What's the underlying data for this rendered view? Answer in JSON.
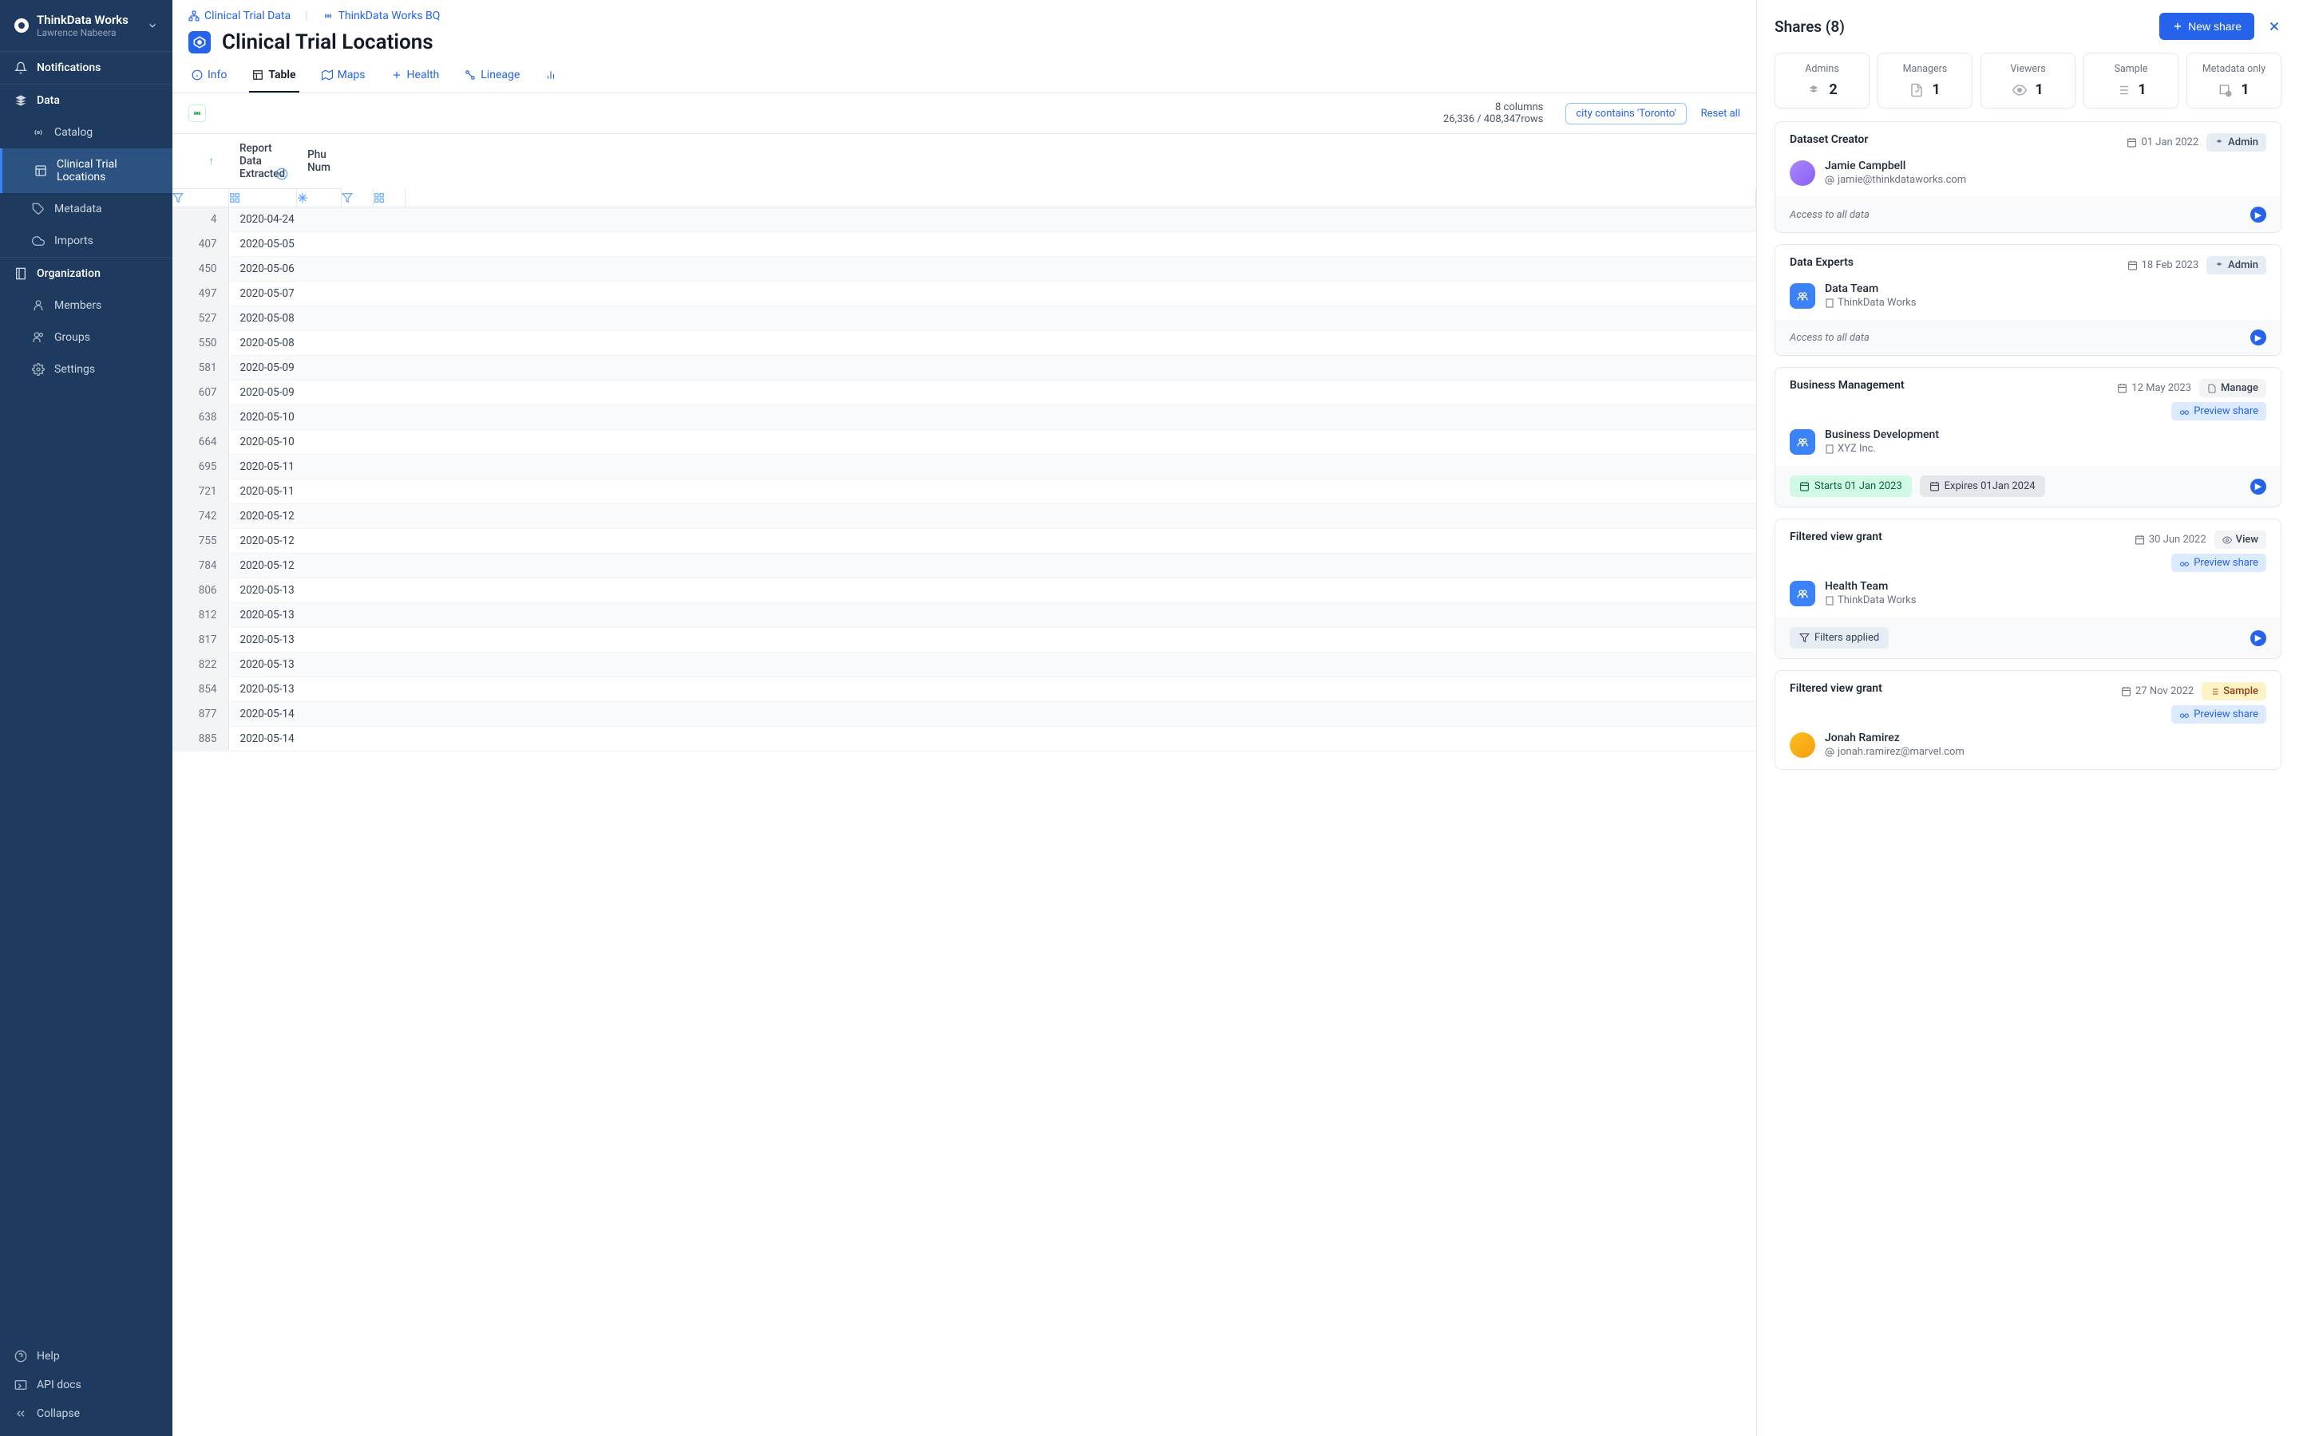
{
  "brand": {
    "name": "ThinkData Works",
    "user": "Lawrence Nabeera"
  },
  "sidebar": {
    "notifications": "Notifications",
    "data": "Data",
    "data_items": [
      "Catalog",
      "Clinical Trial Locations",
      "Metadata",
      "Imports"
    ],
    "organization": "Organization",
    "org_items": [
      "Members",
      "Groups",
      "Settings"
    ],
    "footer": [
      "Help",
      "API docs",
      "Collapse"
    ]
  },
  "breadcrumb": {
    "a": "Clinical Trial Data",
    "b": "ThinkData Works BQ"
  },
  "header": {
    "title": "Clinical Trial Locations"
  },
  "tabs": [
    "Info",
    "Table",
    "Maps",
    "Health",
    "Lineage"
  ],
  "filter": {
    "columns": "8 columns",
    "rows": "26,336 / 408,347rows",
    "chip": "city contains 'Toronto'",
    "reset": "Reset all"
  },
  "table": {
    "headers": [
      "Report Data Extracted",
      "Phu Num"
    ],
    "rows": [
      {
        "n": 4,
        "d": "2020-04-24"
      },
      {
        "n": 407,
        "d": "2020-05-05"
      },
      {
        "n": 450,
        "d": "2020-05-06"
      },
      {
        "n": 497,
        "d": "2020-05-07"
      },
      {
        "n": 527,
        "d": "2020-05-08"
      },
      {
        "n": 550,
        "d": "2020-05-08"
      },
      {
        "n": 581,
        "d": "2020-05-09"
      },
      {
        "n": 607,
        "d": "2020-05-09"
      },
      {
        "n": 638,
        "d": "2020-05-10"
      },
      {
        "n": 664,
        "d": "2020-05-10"
      },
      {
        "n": 695,
        "d": "2020-05-11"
      },
      {
        "n": 721,
        "d": "2020-05-11"
      },
      {
        "n": 742,
        "d": "2020-05-12"
      },
      {
        "n": 755,
        "d": "2020-05-12"
      },
      {
        "n": 784,
        "d": "2020-05-12"
      },
      {
        "n": 806,
        "d": "2020-05-13"
      },
      {
        "n": 812,
        "d": "2020-05-13"
      },
      {
        "n": 817,
        "d": "2020-05-13"
      },
      {
        "n": 822,
        "d": "2020-05-13"
      },
      {
        "n": 854,
        "d": "2020-05-13"
      },
      {
        "n": 877,
        "d": "2020-05-14"
      },
      {
        "n": 885,
        "d": "2020-05-14"
      }
    ]
  },
  "panel": {
    "title": "Shares (8)",
    "new_share": "New share",
    "stats": [
      {
        "label": "Admins",
        "count": "2"
      },
      {
        "label": "Managers",
        "count": "1"
      },
      {
        "label": "Viewers",
        "count": "1"
      },
      {
        "label": "Sample",
        "count": "1"
      },
      {
        "label": "Metadata only",
        "count": "1"
      }
    ],
    "shares": [
      {
        "title": "Dataset Creator",
        "date": "01 Jan 2022",
        "role": "Admin",
        "role_class": "admin",
        "entity": {
          "type": "user",
          "name": "Jamie Campbell",
          "sub": "jamie@thinkdataworks.com",
          "avatar": "female"
        },
        "access": "Access to all data",
        "preview": false
      },
      {
        "title": "Data Experts",
        "date": "18 Feb 2023",
        "role": "Admin",
        "role_class": "admin",
        "entity": {
          "type": "group",
          "name": "Data Team",
          "sub": "ThinkData Works"
        },
        "access": "Access to all data",
        "preview": false
      },
      {
        "title": "Business Management",
        "date": "12 May 2023",
        "role": "Manage",
        "role_class": "manage",
        "entity": {
          "type": "group",
          "name": "Business Development",
          "sub": "XYZ Inc."
        },
        "pills": [
          {
            "cls": "start",
            "text": "Starts 01 Jan 2023"
          },
          {
            "cls": "expire",
            "text": "Expires 01Jan 2024"
          }
        ],
        "preview": true,
        "preview_label": "Preview share"
      },
      {
        "title": "Filtered view grant",
        "date": "30 Jun 2022",
        "role": "View",
        "role_class": "view",
        "entity": {
          "type": "group",
          "name": "Health Team",
          "sub": "ThinkData Works"
        },
        "pills": [
          {
            "cls": "filters",
            "text": "Filters applied"
          }
        ],
        "preview": true,
        "preview_label": "Preview share"
      },
      {
        "title": "Filtered view grant",
        "date": "27 Nov 2022",
        "role": "Sample",
        "role_class": "sample",
        "entity": {
          "type": "user",
          "name": "Jonah Ramirez",
          "sub": "jonah.ramirez@marvel.com",
          "avatar": "male"
        },
        "preview": true,
        "preview_label": "Preview share"
      }
    ]
  }
}
